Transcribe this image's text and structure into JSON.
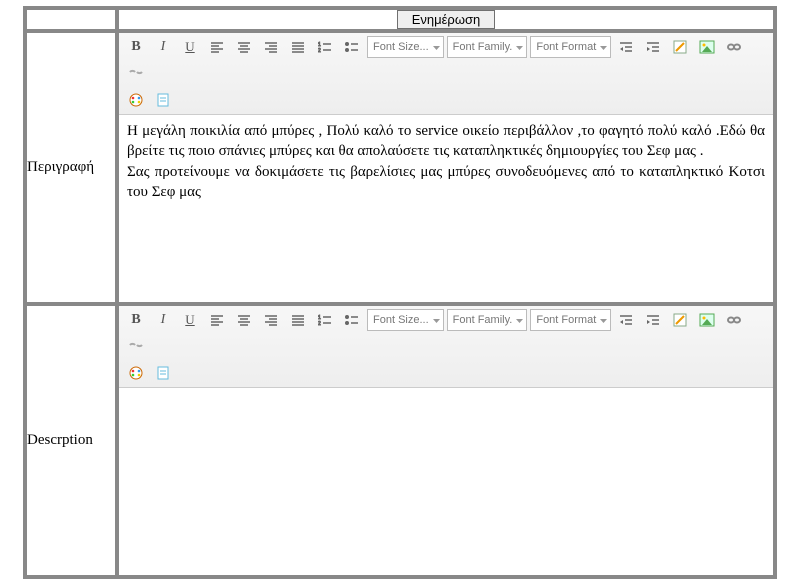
{
  "header": {
    "update_label": "Ενημέρωση"
  },
  "rows": {
    "perigrafi": {
      "label": "Περιγραφή"
    },
    "description": {
      "label": "Descrption"
    }
  },
  "toolbar": {
    "font_size_label": "Font Size...",
    "font_family_label": "Font Family.",
    "font_format_label": "Font Format"
  },
  "content": {
    "perigrafi_p1": "Η μεγάλη ποικιλία από μπύρες , Πολύ καλό το service οικείο περιβάλλον ,το φαγητό πολύ καλό .Εδώ θα βρείτε τις ποιο σπάνιες μπύρες και θα απολαύσετε τις καταπληκτικές δημιουργίες του Σεφ μας .",
    "perigrafi_p2": "Σας προτείνουμε να δοκιμάσετε τις βαρελίσιες μας μπύρες συνοδευόμενες από το καταπληκτικό Κοτσι του Σεφ μας",
    "description_p1": ""
  }
}
